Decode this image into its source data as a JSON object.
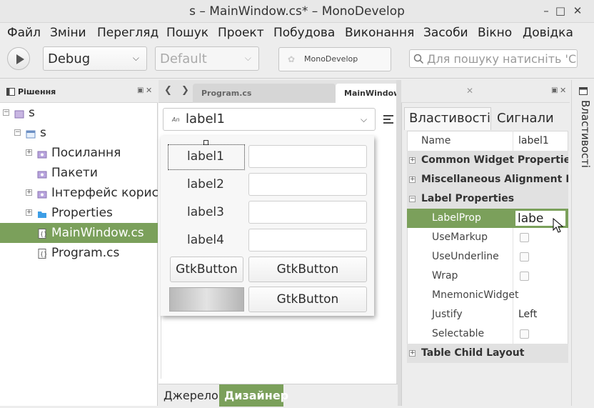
{
  "window": {
    "title": "s – MainWindow.cs* – MonoDevelop",
    "minimize": "–",
    "maximize": "□",
    "close": "✕"
  },
  "menubar": {
    "items": [
      "Файл",
      "Зміни",
      "Перегляд",
      "Пошук",
      "Проект",
      "Побудова",
      "Виконання",
      "Засоби",
      "Вікно",
      "Довідка"
    ]
  },
  "toolbar": {
    "config": "Debug",
    "platform": "Default",
    "status": "MonoDevelop",
    "search_placeholder": "Для пошуку натисніть 'Control+,'"
  },
  "solution_panel": {
    "title": "Рішення",
    "items": [
      {
        "label": "s",
        "indent": 0,
        "expander": "−",
        "icon": "solution"
      },
      {
        "label": "s",
        "indent": 1,
        "expander": "−",
        "icon": "project"
      },
      {
        "label": "Посилання",
        "indent": 2,
        "expander": "+",
        "icon": "references"
      },
      {
        "label": "Пакети",
        "indent": 2,
        "expander": "",
        "icon": "packages"
      },
      {
        "label": "Інтерфейс користувача",
        "indent": 2,
        "expander": "+",
        "icon": "ui"
      },
      {
        "label": "Properties",
        "indent": 2,
        "expander": "+",
        "icon": "folder"
      },
      {
        "label": "MainWindow.cs",
        "indent": 2,
        "expander": "",
        "icon": "file",
        "selected": true
      },
      {
        "label": "Program.cs",
        "indent": 2,
        "expander": "",
        "icon": "file"
      }
    ]
  },
  "editor": {
    "tabs": [
      {
        "label": "Program.cs",
        "active": false
      },
      {
        "label": "MainWindow.cs",
        "active": true
      }
    ],
    "widget_combo_icon": "An",
    "widget_combo": "label1",
    "design": {
      "labels": [
        "label1",
        "label2",
        "label3",
        "label4"
      ],
      "button_left": "GtkButton",
      "button_right_1": "GtkButton",
      "button_right_2": "GtkButton"
    },
    "bottom_tabs": [
      "Джерело",
      "Дизайнер"
    ]
  },
  "properties_panel": {
    "tabs": [
      "Властивості",
      "Сигнали"
    ],
    "rows": [
      {
        "name": "Name",
        "value": "label1",
        "type": "text"
      },
      {
        "name": "Common Widget Properties",
        "type": "category",
        "expander": "+"
      },
      {
        "name": "Miscellaneous Alignment Properties",
        "type": "category",
        "expander": "+"
      },
      {
        "name": "Label Properties",
        "type": "category",
        "expander": "−"
      },
      {
        "name": "LabelProp",
        "value": "labe",
        "type": "editing"
      },
      {
        "name": "UseMarkup",
        "type": "check"
      },
      {
        "name": "UseUnderline",
        "type": "check"
      },
      {
        "name": "Wrap",
        "type": "check"
      },
      {
        "name": "MnemonicWidget",
        "value": "",
        "type": "text"
      },
      {
        "name": "Justify",
        "value": "Left",
        "type": "text"
      },
      {
        "name": "Selectable",
        "type": "check"
      },
      {
        "name": "Table Child Layout",
        "type": "category",
        "expander": "+"
      }
    ],
    "side_label": "Властивості"
  },
  "colors": {
    "selection": "#7ba05b"
  }
}
